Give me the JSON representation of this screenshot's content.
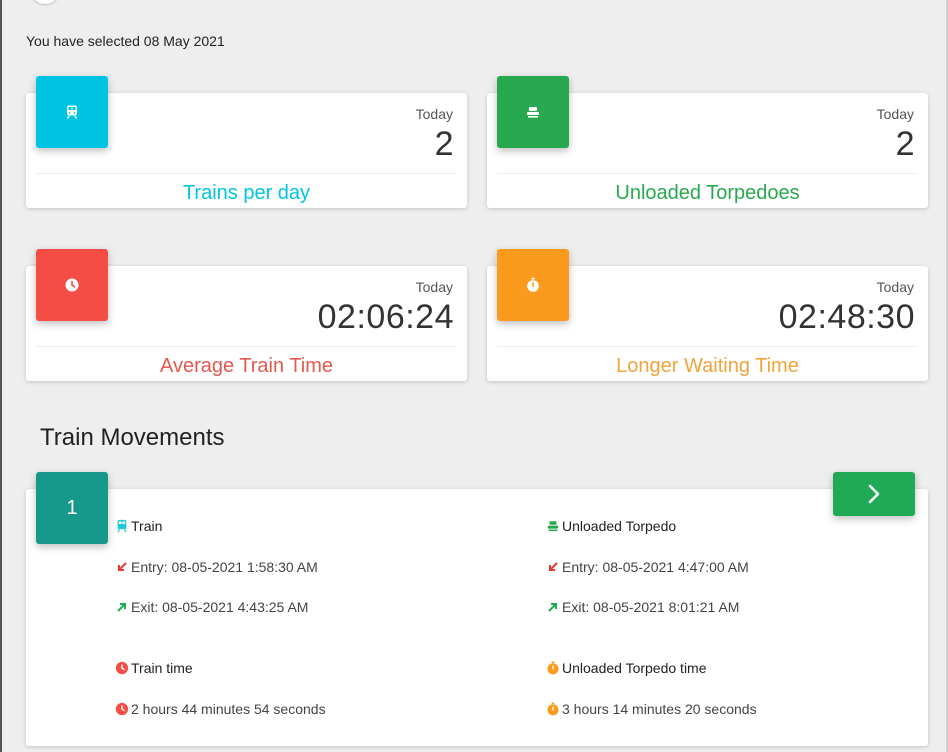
{
  "selected_text": "You have selected 08 May 2021",
  "stats": [
    {
      "id": "trains",
      "caption": "Today",
      "value": "2",
      "label": "Trains per day",
      "color": "#00c5e2",
      "icon": "train-icon"
    },
    {
      "id": "unloaded",
      "caption": "Today",
      "value": "2",
      "label": "Unloaded Torpedoes",
      "color": "#28a84f",
      "icon": "torpedo-icon"
    },
    {
      "id": "avg",
      "caption": "Today",
      "value": "02:06:24",
      "label": "Average Train Time",
      "color": "#f34d45",
      "icon": "clock-icon"
    },
    {
      "id": "wait",
      "caption": "Today",
      "value": "02:48:30",
      "label": "Longer Waiting Time",
      "color": "#fb9a1c",
      "icon": "stopwatch-icon"
    }
  ],
  "movements": {
    "title": "Train Movements",
    "index": "1",
    "train": {
      "title": "Train",
      "entry": "Entry: 08-05-2021 1:58:30 AM",
      "exit": "Exit: 08-05-2021 4:43:25 AM",
      "time_title": "Train time",
      "time_value": "2 hours 44 minutes 54 seconds"
    },
    "torpedo": {
      "title": "Unloaded Torpedo",
      "entry": "Entry: 08-05-2021 4:47:00 AM",
      "exit": "Exit: 08-05-2021 8:01:21 AM",
      "time_title": "Unloaded Torpedo time",
      "time_value": "3 hours 14 minutes 20 seconds"
    }
  },
  "colors": {
    "train_icon": "#1ec8d6",
    "torpedo_icon": "#28a84f",
    "entry_arrow": "#e53935",
    "exit_arrow": "#21aa55",
    "time_red": "#f34d45",
    "time_orange": "#fb9a1c",
    "next_button": "#21aa55",
    "index_box": "#16998a"
  }
}
